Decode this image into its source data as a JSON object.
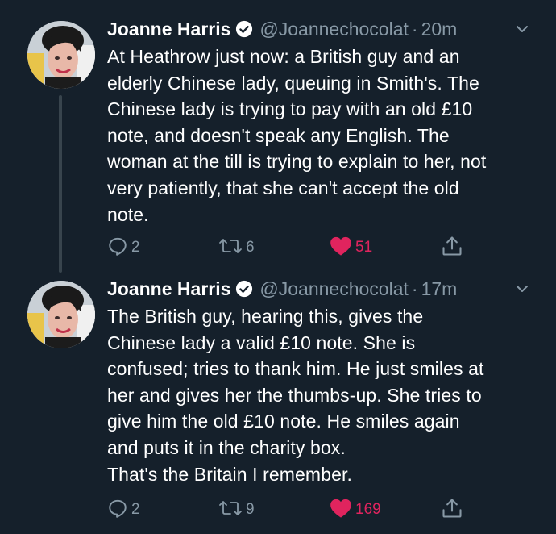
{
  "tweets": [
    {
      "name": "Joanne Harris",
      "handle": "@Joannechocolat",
      "time": "20m",
      "text": "At Heathrow just now: a British guy and an\nelderly Chinese lady, queuing in Smith's. The\nChinese lady is trying to pay with an old £10\nnote, and doesn't speak any English. The\nwoman at the till is trying to explain to her, not\nvery patiently, that she can't accept the old\nnote.",
      "replies": "2",
      "retweets": "6",
      "likes": "51"
    },
    {
      "name": "Joanne Harris",
      "handle": "@Joannechocolat",
      "time": "17m",
      "text": "The British guy, hearing this, gives the\nChinese lady a valid £10 note. She is\nconfused; tries to thank him. He just smiles at\nher and gives her the thumbs-up. She tries to\ngive him the old £10 note. He smiles again\nand puts it in the charity box.\nThat's the Britain I remember.",
      "replies": "2",
      "retweets": "9",
      "likes": "169"
    }
  ],
  "icons": {
    "reply": "reply-icon",
    "retweet": "retweet-icon",
    "like": "heart-icon",
    "share": "share-icon",
    "verified": "verified-badge-icon",
    "caret": "chevron-down-icon"
  },
  "colors": {
    "background": "#15202b",
    "text": "#ffffff",
    "muted": "#8899a6",
    "like": "#e0245e",
    "thread_line": "#38444d"
  }
}
